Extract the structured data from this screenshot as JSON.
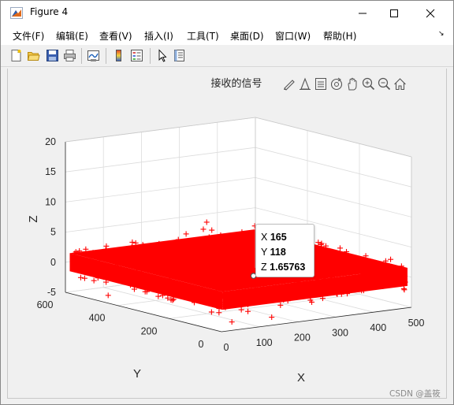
{
  "window": {
    "title": "Figure 4",
    "icons": {
      "app": "matlab-icon",
      "minimize": "minimize-icon",
      "maximize": "maximize-icon",
      "close": "close-icon"
    }
  },
  "menu": {
    "items": [
      "文件(F)",
      "编辑(E)",
      "查看(V)",
      "插入(I)",
      "工具(T)",
      "桌面(D)",
      "窗口(W)",
      "帮助(H)"
    ],
    "undock_glyph": "↘"
  },
  "toolbar": {
    "icons": [
      "new-figure-icon",
      "open-file-icon",
      "save-icon",
      "print-icon",
      "link-plot-icon",
      "insert-colorbar-icon",
      "insert-legend-icon",
      "edit-plot-icon",
      "property-inspector-icon"
    ]
  },
  "axes_toolbar": {
    "icons": [
      "brush-icon",
      "data-tips-icon",
      "restore-view-icon",
      "rotate-3d-icon",
      "pan-icon",
      "zoom-in-icon",
      "zoom-out-icon",
      "home-icon"
    ]
  },
  "chart_data": {
    "type": "scatter",
    "title": "接收的信号",
    "xlabel": "X",
    "ylabel": "Y",
    "zlabel": "Z",
    "marker": "+",
    "color": "#ff0000",
    "xlim": [
      0,
      500
    ],
    "ylim": [
      0,
      600
    ],
    "zlim": [
      -5,
      20
    ],
    "x_ticks": [
      "0",
      "100",
      "200",
      "300",
      "400",
      "500"
    ],
    "y_ticks": [
      "0",
      "200",
      "400",
      "600"
    ],
    "z_ticks": [
      "-5",
      "0",
      "5",
      "10",
      "15",
      "20"
    ],
    "grid": true,
    "datatip": {
      "x": 165,
      "y": 118,
      "z": 1.65763
    }
  },
  "datatip_text": {
    "x_label": "X",
    "x_value": "165",
    "y_label": "Y",
    "y_value": "118",
    "z_label": "Z",
    "z_value": "1.65763"
  },
  "watermark": "CSDN @盖筱"
}
